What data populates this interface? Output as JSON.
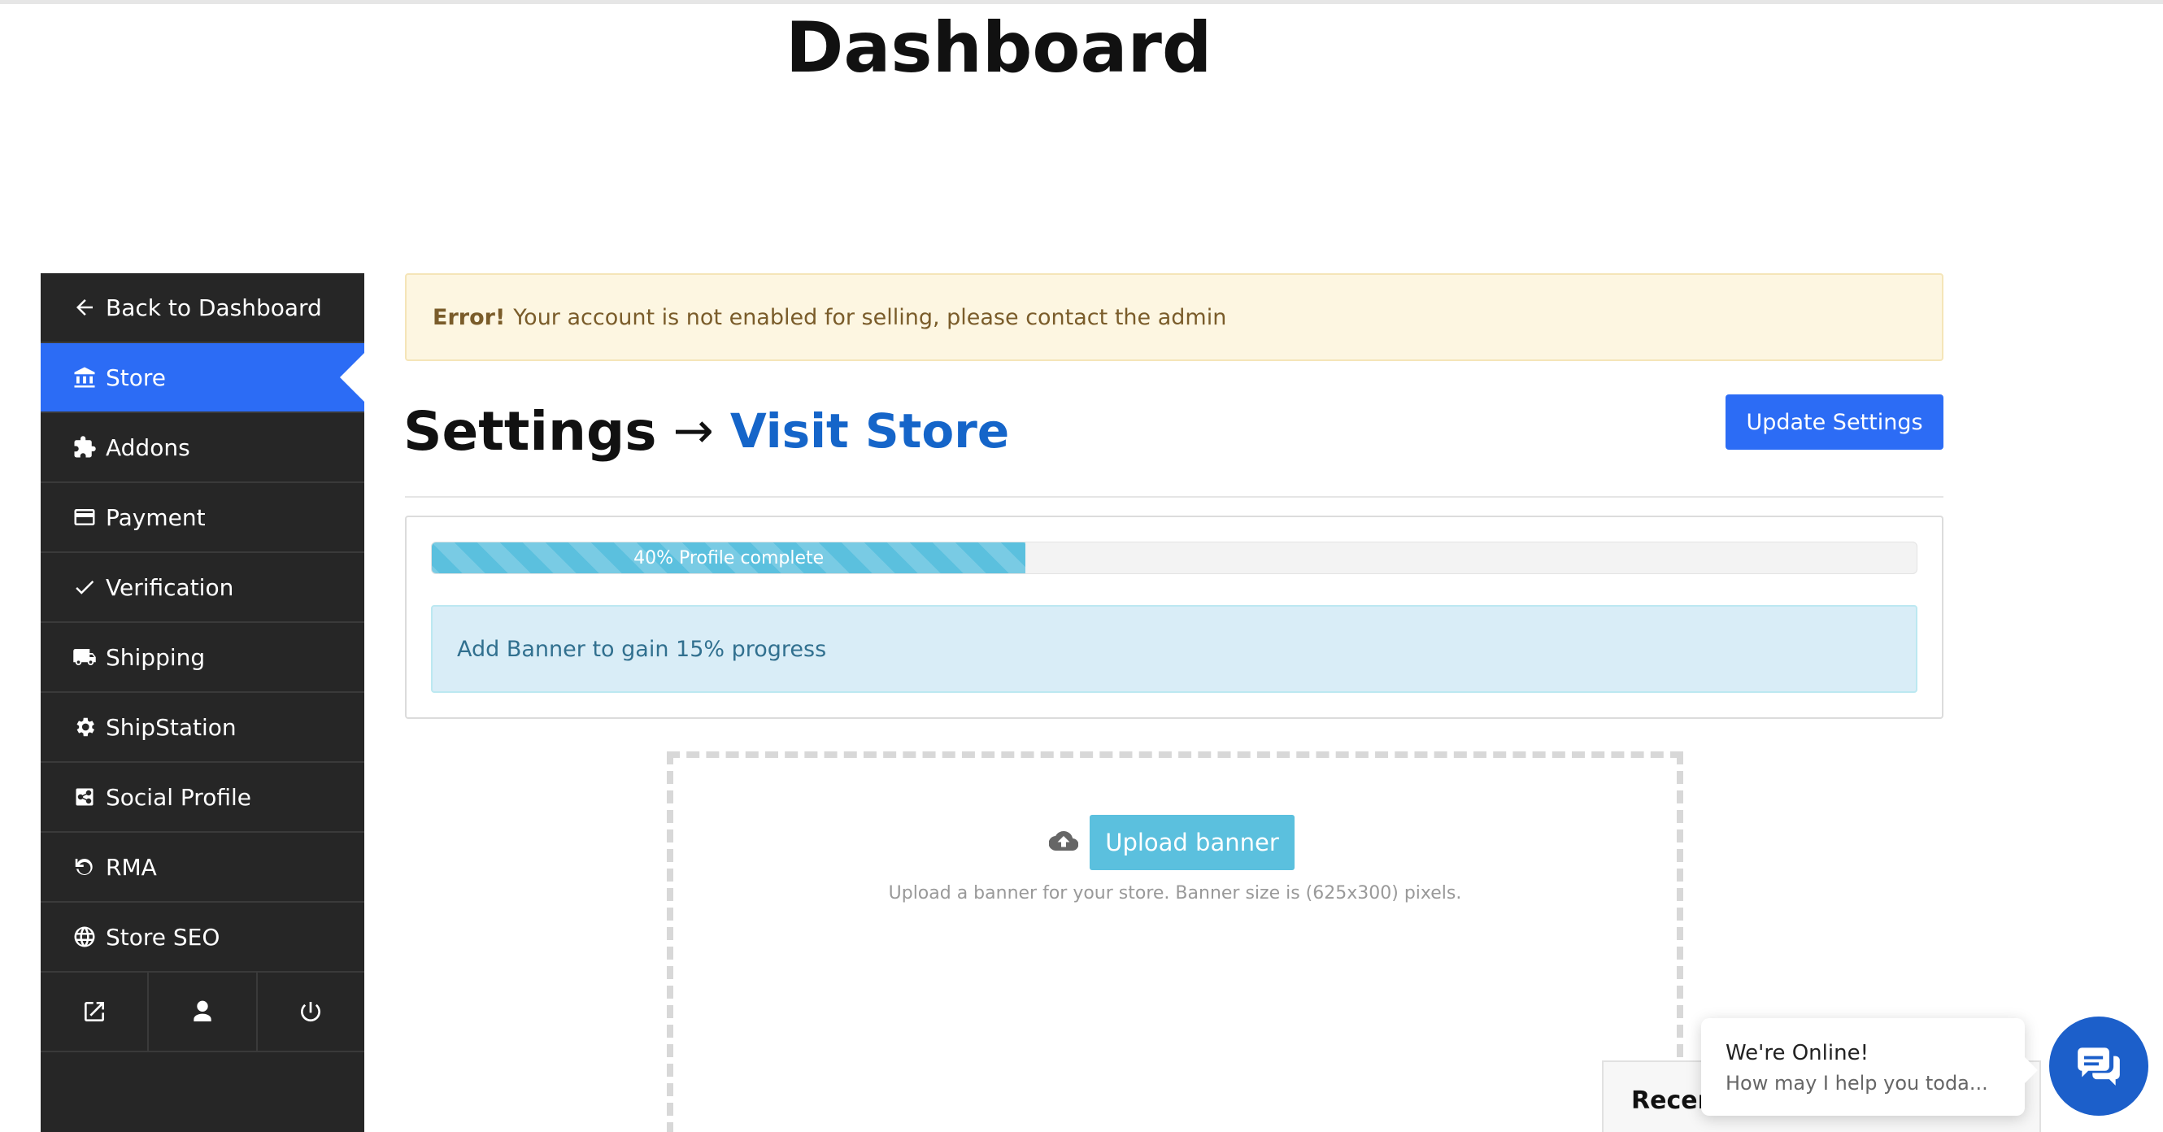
{
  "page": {
    "title": "Dashboard"
  },
  "sidebar": {
    "items": [
      {
        "label": "Back to Dashboard",
        "icon": "arrow-left-icon"
      },
      {
        "label": "Store",
        "icon": "bank-icon",
        "active": true
      },
      {
        "label": "Addons",
        "icon": "puzzle-icon"
      },
      {
        "label": "Payment",
        "icon": "credit-card-icon"
      },
      {
        "label": "Verification",
        "icon": "check-icon"
      },
      {
        "label": "Shipping",
        "icon": "truck-icon"
      },
      {
        "label": "ShipStation",
        "icon": "gear-icon"
      },
      {
        "label": "Social Profile",
        "icon": "share-icon"
      },
      {
        "label": "RMA",
        "icon": "undo-icon"
      },
      {
        "label": "Store SEO",
        "icon": "globe-icon"
      }
    ],
    "footer_icons": [
      "external-link-icon",
      "user-icon",
      "power-icon"
    ],
    "colors": {
      "background": "#262626",
      "active": "#2c6cf5"
    }
  },
  "error_alert": {
    "strong": "Error!",
    "message": "Your account is not enabled for selling, please contact the admin"
  },
  "settings": {
    "heading": "Settings",
    "arrow": "→",
    "visit_store": "Visit Store",
    "update_button": "Update Settings"
  },
  "profile": {
    "progress_percent": 40,
    "progress_label": "40% Profile complete",
    "tip": "Add Banner to gain 15% progress"
  },
  "banner": {
    "upload_button": "Upload banner",
    "hint": "Upload a banner for your store. Banner size is (625x300) pixels."
  },
  "recent_box": {
    "title": "Recen"
  },
  "chat": {
    "line1": "We're Online!",
    "line2": "How may I help you toda..."
  }
}
